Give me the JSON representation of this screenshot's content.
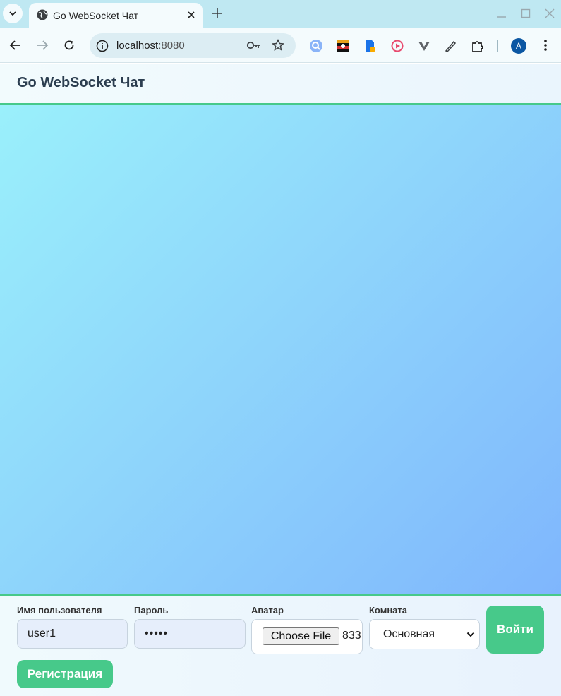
{
  "browser": {
    "tab_title": "Go WebSocket Чат",
    "url_host": "localhost",
    "url_port": ":8080",
    "profile_initial": "A"
  },
  "app": {
    "title": "Go WebSocket Чат",
    "form": {
      "username_label": "Имя пользователя",
      "username_value": "user1",
      "password_label": "Пароль",
      "password_value": "•••••",
      "avatar_label": "Аватар",
      "file_button": "Choose File",
      "file_name": "833",
      "room_label": "Комната",
      "room_selected": "Основная",
      "login_button": "Войти",
      "register_button": "Регистрация"
    }
  },
  "colors": {
    "accent": "#47c98a",
    "chat_gradient_start": "#9af0fb",
    "chat_gradient_end": "#7fb6fd"
  }
}
